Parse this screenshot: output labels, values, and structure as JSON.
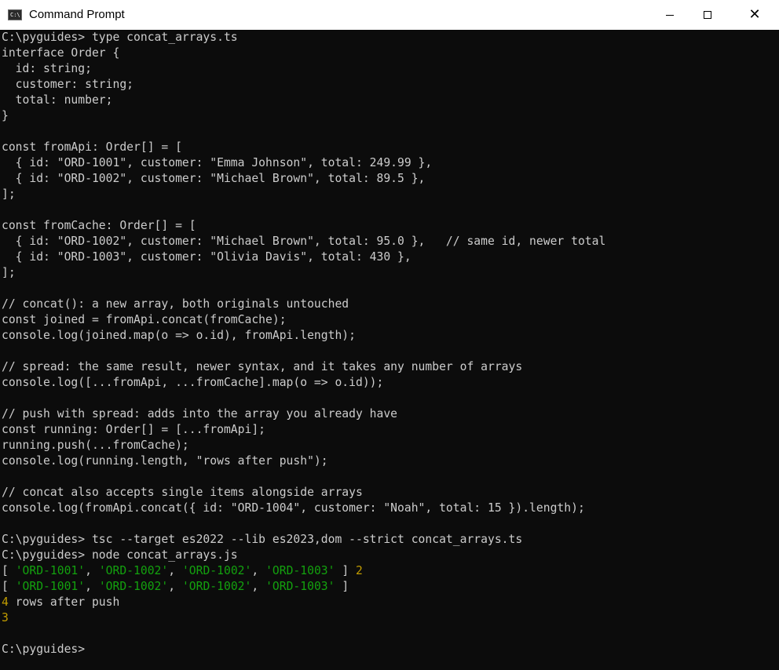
{
  "window": {
    "title": "Command Prompt",
    "icon": "cmd-icon",
    "controls": {
      "minimize": "minimize-icon",
      "maximize": "maximize-icon",
      "close": "close-icon"
    }
  },
  "colors": {
    "background": "#0c0c0c",
    "text": "#cccccc",
    "string": "#13a10e",
    "number": "#c19c00"
  },
  "terminal": {
    "lines": [
      [
        {
          "t": "C:\\pyguides> type concat_arrays.ts"
        }
      ],
      [
        {
          "t": "interface Order {"
        }
      ],
      [
        {
          "t": "  id: string;"
        }
      ],
      [
        {
          "t": "  customer: string;"
        }
      ],
      [
        {
          "t": "  total: number;"
        }
      ],
      [
        {
          "t": "}"
        }
      ],
      [
        {
          "t": ""
        }
      ],
      [
        {
          "t": "const fromApi: Order[] = ["
        }
      ],
      [
        {
          "t": "  { id: \"ORD-1001\", customer: \"Emma Johnson\", total: 249.99 },"
        }
      ],
      [
        {
          "t": "  { id: \"ORD-1002\", customer: \"Michael Brown\", total: 89.5 },"
        }
      ],
      [
        {
          "t": "];"
        }
      ],
      [
        {
          "t": ""
        }
      ],
      [
        {
          "t": "const fromCache: Order[] = ["
        }
      ],
      [
        {
          "t": "  { id: \"ORD-1002\", customer: \"Michael Brown\", total: 95.0 },   // same id, newer total"
        }
      ],
      [
        {
          "t": "  { id: \"ORD-1003\", customer: \"Olivia Davis\", total: 430 },"
        }
      ],
      [
        {
          "t": "];"
        }
      ],
      [
        {
          "t": ""
        }
      ],
      [
        {
          "t": "// concat(): a new array, both originals untouched"
        }
      ],
      [
        {
          "t": "const joined = fromApi.concat(fromCache);"
        }
      ],
      [
        {
          "t": "console.log(joined.map(o => o.id), fromApi.length);"
        }
      ],
      [
        {
          "t": ""
        }
      ],
      [
        {
          "t": "// spread: the same result, newer syntax, and it takes any number of arrays"
        }
      ],
      [
        {
          "t": "console.log([...fromApi, ...fromCache].map(o => o.id));"
        }
      ],
      [
        {
          "t": ""
        }
      ],
      [
        {
          "t": "// push with spread: adds into the array you already have"
        }
      ],
      [
        {
          "t": "const running: Order[] = [...fromApi];"
        }
      ],
      [
        {
          "t": "running.push(...fromCache);"
        }
      ],
      [
        {
          "t": "console.log(running.length, \"rows after push\");"
        }
      ],
      [
        {
          "t": ""
        }
      ],
      [
        {
          "t": "// concat also accepts single items alongside arrays"
        }
      ],
      [
        {
          "t": "console.log(fromApi.concat({ id: \"ORD-1004\", customer: \"Noah\", total: 15 }).length);"
        }
      ],
      [
        {
          "t": ""
        }
      ],
      [
        {
          "t": "C:\\pyguides> tsc --target es2022 --lib es2023,dom --strict concat_arrays.ts"
        }
      ],
      [
        {
          "t": "C:\\pyguides> node concat_arrays.js"
        }
      ],
      [
        {
          "t": "[ "
        },
        {
          "t": "'ORD-1001'",
          "c": "green"
        },
        {
          "t": ", "
        },
        {
          "t": "'ORD-1002'",
          "c": "green"
        },
        {
          "t": ", "
        },
        {
          "t": "'ORD-1002'",
          "c": "green"
        },
        {
          "t": ", "
        },
        {
          "t": "'ORD-1003'",
          "c": "green"
        },
        {
          "t": " ] "
        },
        {
          "t": "2",
          "c": "yellow"
        }
      ],
      [
        {
          "t": "[ "
        },
        {
          "t": "'ORD-1001'",
          "c": "green"
        },
        {
          "t": ", "
        },
        {
          "t": "'ORD-1002'",
          "c": "green"
        },
        {
          "t": ", "
        },
        {
          "t": "'ORD-1002'",
          "c": "green"
        },
        {
          "t": ", "
        },
        {
          "t": "'ORD-1003'",
          "c": "green"
        },
        {
          "t": " ]"
        }
      ],
      [
        {
          "t": "4",
          "c": "yellow"
        },
        {
          "t": " rows after push"
        }
      ],
      [
        {
          "t": "3",
          "c": "yellow"
        }
      ],
      [
        {
          "t": ""
        }
      ],
      [
        {
          "t": "C:\\pyguides>"
        }
      ]
    ]
  }
}
